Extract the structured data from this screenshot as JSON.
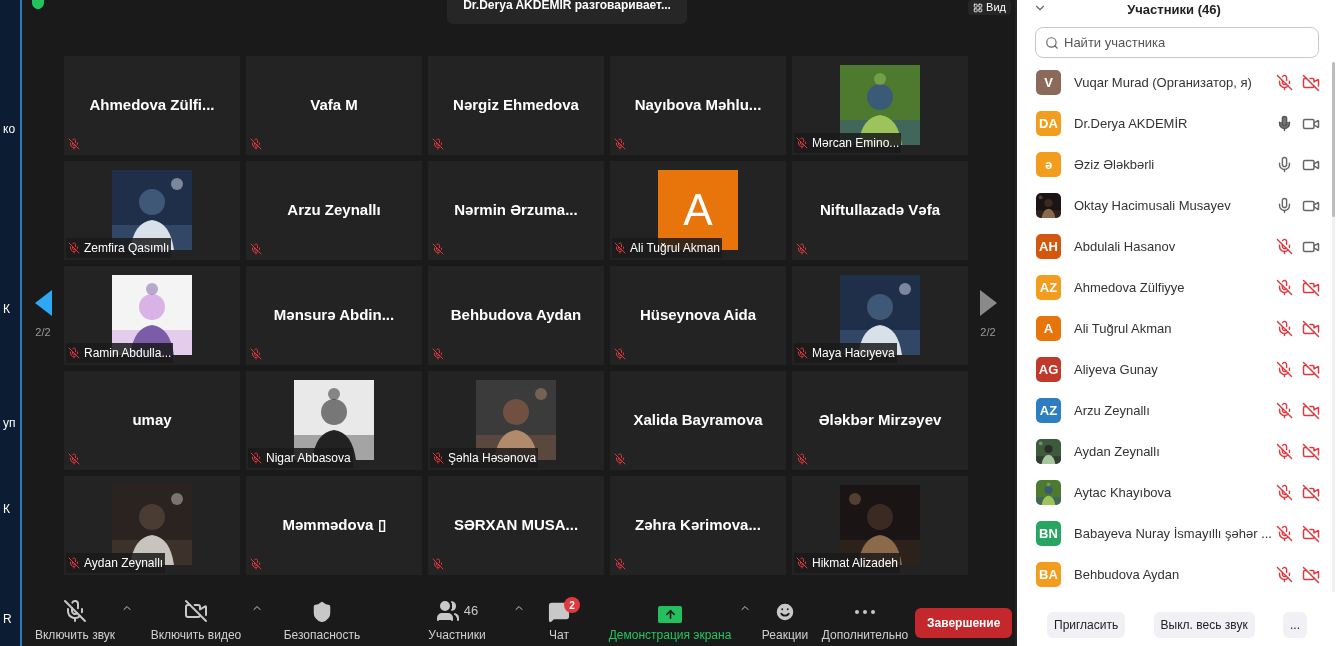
{
  "desktop": {
    "labels": [
      "ко",
      "К",
      "уп",
      "К",
      "R"
    ]
  },
  "top_bar": {
    "speaker_banner": "Dr.Derya AKDEMIR разговаривает...",
    "view_button": "Вид"
  },
  "grid": {
    "page_left": "2/2",
    "page_right": "2/2",
    "tiles": [
      {
        "kind": "name",
        "name": "Ahmedova  Zülfi...",
        "muted": true
      },
      {
        "kind": "name",
        "name": "Vafa M",
        "muted": true
      },
      {
        "kind": "name",
        "name": "Nərgiz Ehmedova",
        "muted": true
      },
      {
        "kind": "name",
        "name": "Nayıbova  Məhlu...",
        "muted": true
      },
      {
        "kind": "picture",
        "name": "Mərcan Emino...",
        "muted": true
      },
      {
        "kind": "picture",
        "name": "Zemfira Qasımlı",
        "muted": true
      },
      {
        "kind": "name",
        "name": "Arzu Zeynallı",
        "muted": true
      },
      {
        "kind": "name",
        "name": "Nərmin  Ərzuma...",
        "muted": true
      },
      {
        "kind": "letter",
        "letter": "A",
        "color": "#e8740c",
        "name": "Ali Tuğrul Akman",
        "muted": true
      },
      {
        "kind": "name",
        "name": "Niftullazadə Vəfa",
        "muted": true
      },
      {
        "kind": "picture",
        "name": "Ramin Abdulla...",
        "muted": true
      },
      {
        "kind": "name",
        "name": "Mənsurə  Abdin...",
        "muted": true
      },
      {
        "kind": "name",
        "name": "Behbudova Aydan",
        "muted": true
      },
      {
        "kind": "name",
        "name": "Hüseynova Aida",
        "muted": true
      },
      {
        "kind": "picture",
        "name": "Maya Hacıyeva",
        "muted": true
      },
      {
        "kind": "name",
        "name": "umay",
        "muted": true
      },
      {
        "kind": "picture",
        "name": "Nigar Abbasova",
        "muted": true
      },
      {
        "kind": "picture",
        "name": "Şəhla Həsənova",
        "muted": true
      },
      {
        "kind": "name",
        "name": "Xalida Bayramova",
        "muted": true
      },
      {
        "kind": "name",
        "name": "Ələkbər Mirzəyev",
        "muted": true
      },
      {
        "kind": "picture",
        "name": "Aydan Zeynallı",
        "muted": true
      },
      {
        "kind": "name",
        "name": "Məmmədova ▯",
        "muted": true
      },
      {
        "kind": "name",
        "name": "SƏRXAN  MUSA...",
        "muted": true
      },
      {
        "kind": "name",
        "name": "Zəhra  Kərimova...",
        "muted": true
      },
      {
        "kind": "picture",
        "name": "Hikmat Alizadeh",
        "muted": true
      }
    ]
  },
  "participants_panel": {
    "title": "Участники (46)",
    "search": {
      "placeholder": "Найти участника"
    },
    "participants": [
      {
        "kind": "initials",
        "initials": "V",
        "color": "#8b6a5c",
        "name": "Vuqar Murad (Организатор, я)",
        "mic_muted": true,
        "speaking": false,
        "video_off": true
      },
      {
        "kind": "initials",
        "initials": "DA",
        "color": "#f29d1d",
        "name": "Dr.Derya AKDEMİR",
        "mic_muted": false,
        "speaking": true,
        "video_off": false
      },
      {
        "kind": "initials",
        "initials": "ə",
        "color": "#f29d1d",
        "name": "Əziz Ələkbərli",
        "mic_muted": false,
        "speaking": false,
        "video_off": false
      },
      {
        "kind": "picture",
        "name": "Oktay Hacimusali Musayev",
        "mic_muted": false,
        "speaking": false,
        "video_off": false
      },
      {
        "kind": "initials",
        "initials": "AH",
        "color": "#d4570f",
        "name": "Abdulali Hasanov",
        "mic_muted": true,
        "speaking": false,
        "video_off": false
      },
      {
        "kind": "initials",
        "initials": "AZ",
        "color": "#f29d1d",
        "name": "Ahmedova Zülfiyye",
        "mic_muted": true,
        "speaking": false,
        "video_off": true
      },
      {
        "kind": "initials",
        "initials": "A",
        "color": "#e8740c",
        "name": "Ali Tuğrul Akman",
        "mic_muted": true,
        "speaking": false,
        "video_off": true
      },
      {
        "kind": "initials",
        "initials": "AG",
        "color": "#c0392b",
        "name": "Aliyeva Gunay",
        "mic_muted": true,
        "speaking": false,
        "video_off": true
      },
      {
        "kind": "initials",
        "initials": "AZ",
        "color": "#2e7fc1",
        "name": "Arzu Zeynallı",
        "mic_muted": true,
        "speaking": false,
        "video_off": true
      },
      {
        "kind": "picture",
        "name": "Aydan Zeynallı",
        "mic_muted": true,
        "speaking": false,
        "video_off": true
      },
      {
        "kind": "picture",
        "name": "Aytac Khayıbova",
        "mic_muted": true,
        "speaking": false,
        "video_off": true
      },
      {
        "kind": "initials",
        "initials": "BN",
        "color": "#27a561",
        "name": "Babayeva Nuray İsmayıllı şəhər ...",
        "mic_muted": true,
        "speaking": false,
        "video_off": true
      },
      {
        "kind": "initials",
        "initials": "BA",
        "color": "#f29d1d",
        "name": "Behbudova Aydan",
        "mic_muted": true,
        "speaking": false,
        "video_off": true
      }
    ],
    "buttons": [
      "Пригласить",
      "Выкл. весь звук",
      "..."
    ]
  },
  "toolbar": {
    "items": [
      {
        "kind": "audio",
        "label": "Включить звук",
        "muted": true
      },
      {
        "kind": "video",
        "label": "Включить видео",
        "muted": true
      },
      {
        "kind": "security",
        "label": "Безопасность"
      },
      {
        "kind": "participants",
        "label": "Участники",
        "count": "46"
      },
      {
        "kind": "chat",
        "label": "Чат",
        "badge": "2"
      },
      {
        "kind": "share",
        "label": "Демонстрация экрана"
      },
      {
        "kind": "reactions",
        "label": "Реакции"
      },
      {
        "kind": "more",
        "label": "Дополнительно"
      }
    ],
    "end_button": "Завершение"
  }
}
